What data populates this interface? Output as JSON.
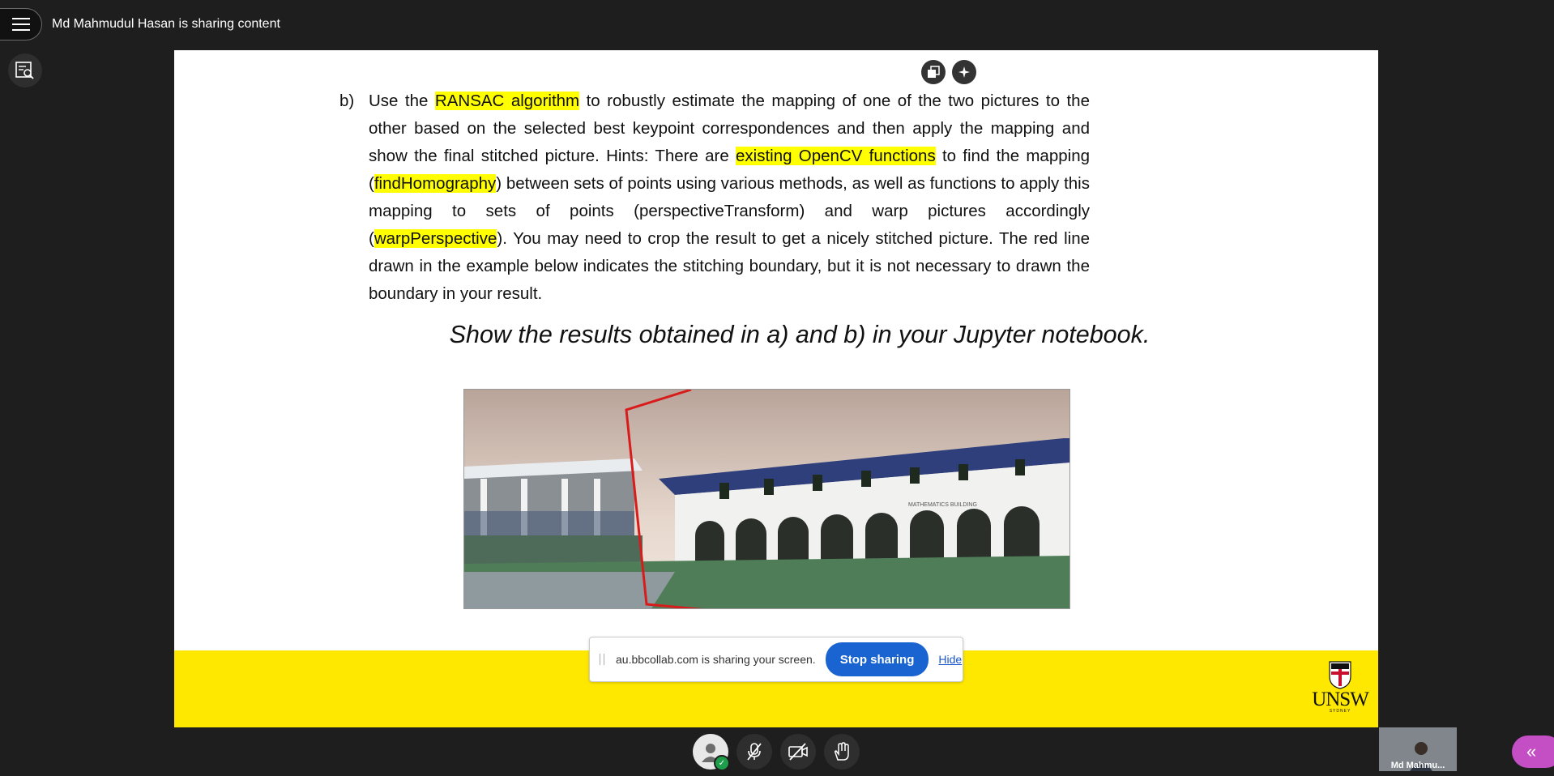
{
  "header": {
    "sharing_text": "Md Mahmudul Hasan is sharing content"
  },
  "slide": {
    "item_label": "b)",
    "paragraph": [
      {
        "text": "Use the ",
        "hl": false
      },
      {
        "text": "RANSAC algorithm",
        "hl": true
      },
      {
        "text": " to robustly estimate the mapping of one of the two pictures to the other based on the selected best keypoint correspondences and then apply the mapping and show the final stitched picture. Hints: There are ",
        "hl": false
      },
      {
        "text": "existing OpenCV functions",
        "hl": true
      },
      {
        "text": " to find the mapping (",
        "hl": false
      },
      {
        "text": "findHomography",
        "hl": true
      },
      {
        "text": ") between sets of points using various methods, as well as functions to apply this mapping to sets of points (perspectiveTransform) and warp pictures accordingly (",
        "hl": false
      },
      {
        "text": "warpPerspective",
        "hl": true
      },
      {
        "text": "). You may need to crop the result to get a nicely stitched picture. The red line drawn in the example below indicates the stitching boundary, but it is not necessary to drawn the boundary in your result.",
        "hl": false
      }
    ],
    "show_line": "Show the results obtained in a) and b) in your Jupyter notebook.",
    "building_sign": "MATHEMATICS BUILDING",
    "logo_text": "UNSW",
    "logo_sub": "SYDNEY"
  },
  "share_bar": {
    "message": "au.bbcollab.com is sharing your screen.",
    "stop_label": "Stop sharing",
    "hide_label": "Hide"
  },
  "participant": {
    "name": "Md Mahmu..."
  },
  "colors": {
    "highlight": "#ffff00",
    "footer": "#ffe800",
    "stop_button": "#1a64d2",
    "collab_button": "#c44ec4"
  }
}
